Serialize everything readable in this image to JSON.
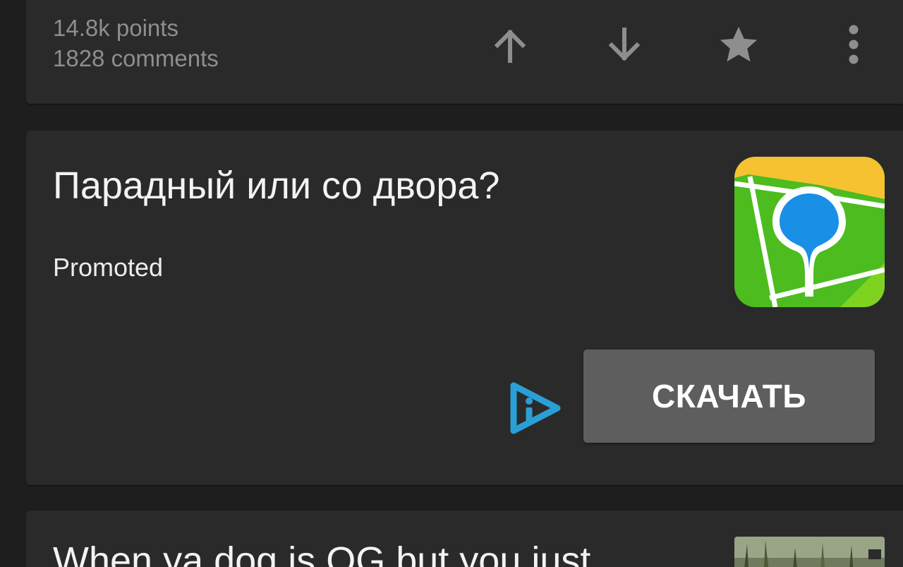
{
  "post_footer": {
    "points": "14.8k points",
    "comments": "1828 comments",
    "actions": {
      "upvote_icon": "arrow-up-icon",
      "downvote_icon": "arrow-down-icon",
      "save_icon": "star-icon",
      "more_icon": "more-vertical-icon"
    },
    "icon_color": "#8e8e8e"
  },
  "promoted_post": {
    "title": "Парадный или со двора?",
    "label": "Promoted",
    "app_icon": "2gis-map-pin-icon",
    "ad_choices_icon": "adchoices-icon",
    "cta_label": "СКАЧАТЬ",
    "colors": {
      "icon_green": "#4cbc1e",
      "icon_yellow": "#f6c232",
      "icon_blue": "#1a8fe6",
      "ad_choices": "#2a9fd6"
    }
  },
  "next_post": {
    "title": "When ya dog is OG but you just",
    "thumbnail_icon": "image-thumbnail"
  }
}
